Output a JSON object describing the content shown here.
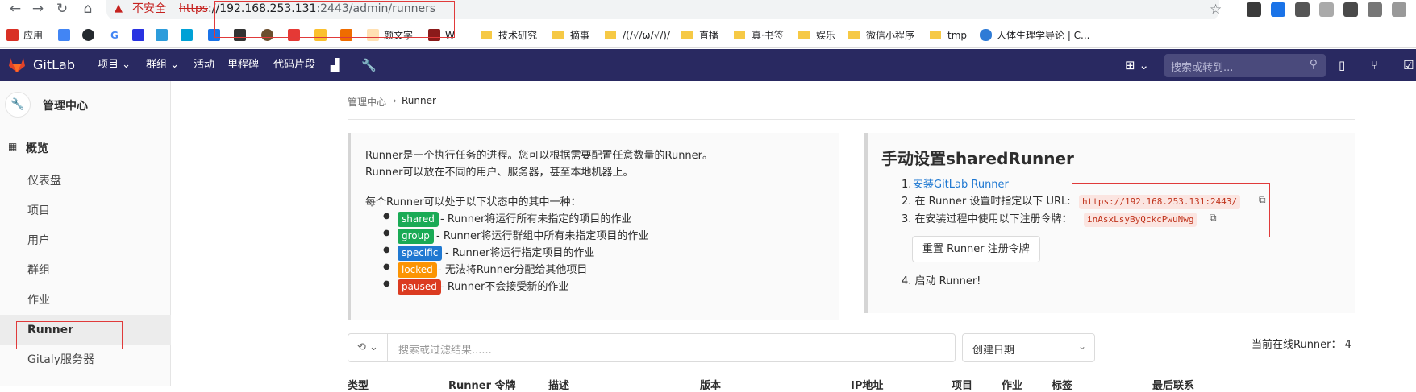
{
  "browser": {
    "insecure_label": "不安全",
    "url_scheme": "https",
    "url_host": "://192.168.253.131",
    "url_rest": ":2443/admin/runners"
  },
  "bookmarks": [
    {
      "label": "应用"
    },
    {
      "label": "G"
    },
    {
      "label": "颜文字"
    },
    {
      "label": "W"
    },
    {
      "label": "技术研究"
    },
    {
      "label": "摘事"
    },
    {
      "label": "/(/√/ω/√/)/"
    },
    {
      "label": "直播"
    },
    {
      "label": "真·书签"
    },
    {
      "label": "娱乐"
    },
    {
      "label": "微信小程序"
    },
    {
      "label": "tmp"
    },
    {
      "label": "人体生理学导论 | C..."
    }
  ],
  "topnav": {
    "brand": "GitLab",
    "items": [
      {
        "label": "项目 ⌄"
      },
      {
        "label": "群组 ⌄"
      },
      {
        "label": "活动"
      },
      {
        "label": "里程碑"
      },
      {
        "label": "代码片段"
      }
    ],
    "search_placeholder": "搜索或转到..."
  },
  "sidebar": {
    "title": "管理中心",
    "section": "概览",
    "items": [
      {
        "label": "仪表盘"
      },
      {
        "label": "项目"
      },
      {
        "label": "用户"
      },
      {
        "label": "群组"
      },
      {
        "label": "作业"
      },
      {
        "label": "Runner"
      },
      {
        "label": "Gitaly服务器"
      }
    ]
  },
  "breadcrumb": {
    "parent": "管理中心",
    "sep": "›",
    "current": "Runner"
  },
  "info": {
    "line1": "Runner是一个执行任务的进程。您可以根据需要配置任意数量的Runner。",
    "line2": "Runner可以放在不同的用户、服务器，甚至本地机器上。",
    "line3": "每个Runner可以处于以下状态中的其中一种：",
    "states": [
      {
        "badge": "shared",
        "color": "#1aaa55",
        "desc": "- Runner将运行所有未指定的项目的作业"
      },
      {
        "badge": "group",
        "color": "#1aaa55",
        "desc": "- Runner将运行群组中所有未指定项目的作业"
      },
      {
        "badge": "specific",
        "color": "#1f78d1",
        "desc": "- Runner将运行指定项目的作业"
      },
      {
        "badge": "locked",
        "color": "#fc9403",
        "desc": "- 无法将Runner分配给其他项目"
      },
      {
        "badge": "paused",
        "color": "#db3b21",
        "desc": "- Runner不会接受新的作业"
      }
    ]
  },
  "setup": {
    "title": "手动设置sharedRunner",
    "step1_num": "1.",
    "step1_link": "安装GitLab Runner",
    "step2": "2. 在 Runner 设置时指定以下 URL:",
    "url_code": "https://192.168.253.131:2443/",
    "step3": "3. 在安装过程中使用以下注册令牌：",
    "token_code": "inAsxLsyByQckcPwuNwg",
    "reset_button": "重置 Runner 注册令牌",
    "step4": "4. 启动 Runner!"
  },
  "filter": {
    "placeholder": "搜索或过滤结果......",
    "sort_label": "创建日期"
  },
  "online_count": "当前在线Runner： 4",
  "table_headers": [
    {
      "label": "类型"
    },
    {
      "label": "Runner 令牌"
    },
    {
      "label": "描述"
    },
    {
      "label": "版本"
    },
    {
      "label": "IP地址"
    },
    {
      "label": "项目"
    },
    {
      "label": "作业"
    },
    {
      "label": "标签"
    },
    {
      "label": "最后联系"
    }
  ],
  "colors": {
    "nav_bg": "#292961",
    "link": "#1f78d1",
    "highlight_box": "#e03a3a"
  }
}
